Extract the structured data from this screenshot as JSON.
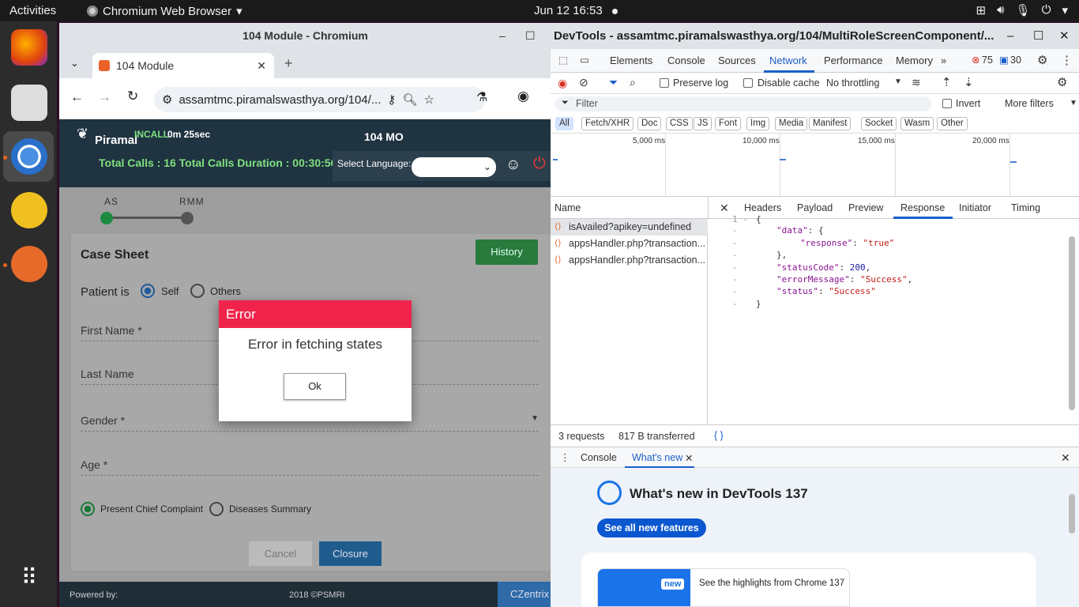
{
  "topbar": {
    "activities": "Activities",
    "app": "Chromium Web Browser",
    "clock": "Jun 12  16:53"
  },
  "browser": {
    "window_title": "104 Module - Chromium",
    "tab_title": "104 Module",
    "url": "assamtmc.piramalswasthya.org/104/..."
  },
  "page": {
    "logo": "Piramal",
    "incall": "INCALL",
    "call_timer": "0m 25sec",
    "role": "104 MO",
    "calls_summary": "Total Calls : 16 Total Calls Duration : 00:30:56",
    "select_language": "Select Language:",
    "stepper": [
      "AS",
      "RMM"
    ],
    "card_title": "Case Sheet",
    "history_button": "History",
    "patient_is": "Patient is",
    "radio_self": "Self",
    "radio_others": "Others",
    "first_name": "First Name *",
    "last_name": "Last Name",
    "gender": "Gender *",
    "age": "Age *",
    "radio_complaint": "Present Chief Complaint",
    "radio_diseases": "Diseases Summary",
    "cancel": "Cancel",
    "closure": "Closure",
    "powered_by": "Powered by:",
    "copyright": "2018 ©PSMRI",
    "czentrix": "CZentrix"
  },
  "modal": {
    "title": "Error",
    "message": "Error in fetching states",
    "ok": "Ok"
  },
  "devtools": {
    "title": "DevTools - assamtmc.piramalswasthya.org/104/MultiRoleScreenComponent/...",
    "tabs": [
      "Elements",
      "Console",
      "Sources",
      "Network",
      "Performance",
      "Memory"
    ],
    "errors": "75",
    "messages": "30",
    "preserve_log": "Preserve log",
    "disable_cache": "Disable cache",
    "throttling": "No throttling",
    "filter_placeholder": "Filter",
    "invert": "Invert",
    "more_filters": "More filters",
    "type_filters": [
      "All",
      "Fetch/XHR",
      "Doc",
      "CSS",
      "JS",
      "Font",
      "Img",
      "Media",
      "Manifest",
      "Socket",
      "Wasm",
      "Other"
    ],
    "timeline_ticks": [
      "5,000 ms",
      "10,000 ms",
      "15,000 ms",
      "20,000 ms"
    ],
    "name_header": "Name",
    "detail_tabs": [
      "Headers",
      "Payload",
      "Preview",
      "Response",
      "Initiator",
      "Timing"
    ],
    "requests": [
      "isAvailed?apikey=undefined",
      "appsHandler.php?transaction...",
      "appsHandler.php?transaction..."
    ],
    "status_requests": "3 requests",
    "status_transferred": "817 B transferred",
    "drawer_tabs": [
      "Console",
      "What's new"
    ],
    "whatsnew_title": "What's new in DevTools 137",
    "see_all": "See all new features",
    "badge_new": "new",
    "highlights": "See the highlights from Chrome 137"
  }
}
